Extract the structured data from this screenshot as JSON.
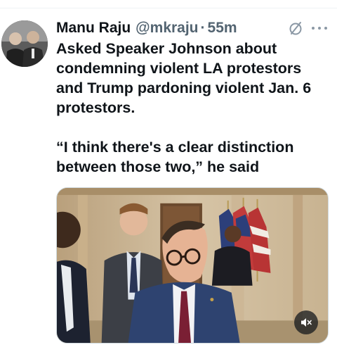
{
  "tweet": {
    "author": {
      "display_name": "Manu Raju",
      "handle": "@mkraju",
      "separator": "·",
      "time_ago": "55m"
    },
    "text_lines": [
      "Asked Speaker Johnson about",
      "condemning violent LA protestors",
      "and Trump pardoning violent Jan. 6",
      "protestors."
    ],
    "quote_lines": [
      "“I think there's a clear distinction",
      "between those two,” he said"
    ],
    "media": {
      "type": "video",
      "mute_icon": "speaker-muted-icon"
    }
  },
  "icons": {
    "grok": "grok-slash-circle-icon",
    "more": "more-horizontal-icon"
  },
  "colors": {
    "text_primary": "#0f1419",
    "text_secondary": "#536471",
    "divider": "#eff3f4",
    "media_border": "#cfd9de"
  }
}
